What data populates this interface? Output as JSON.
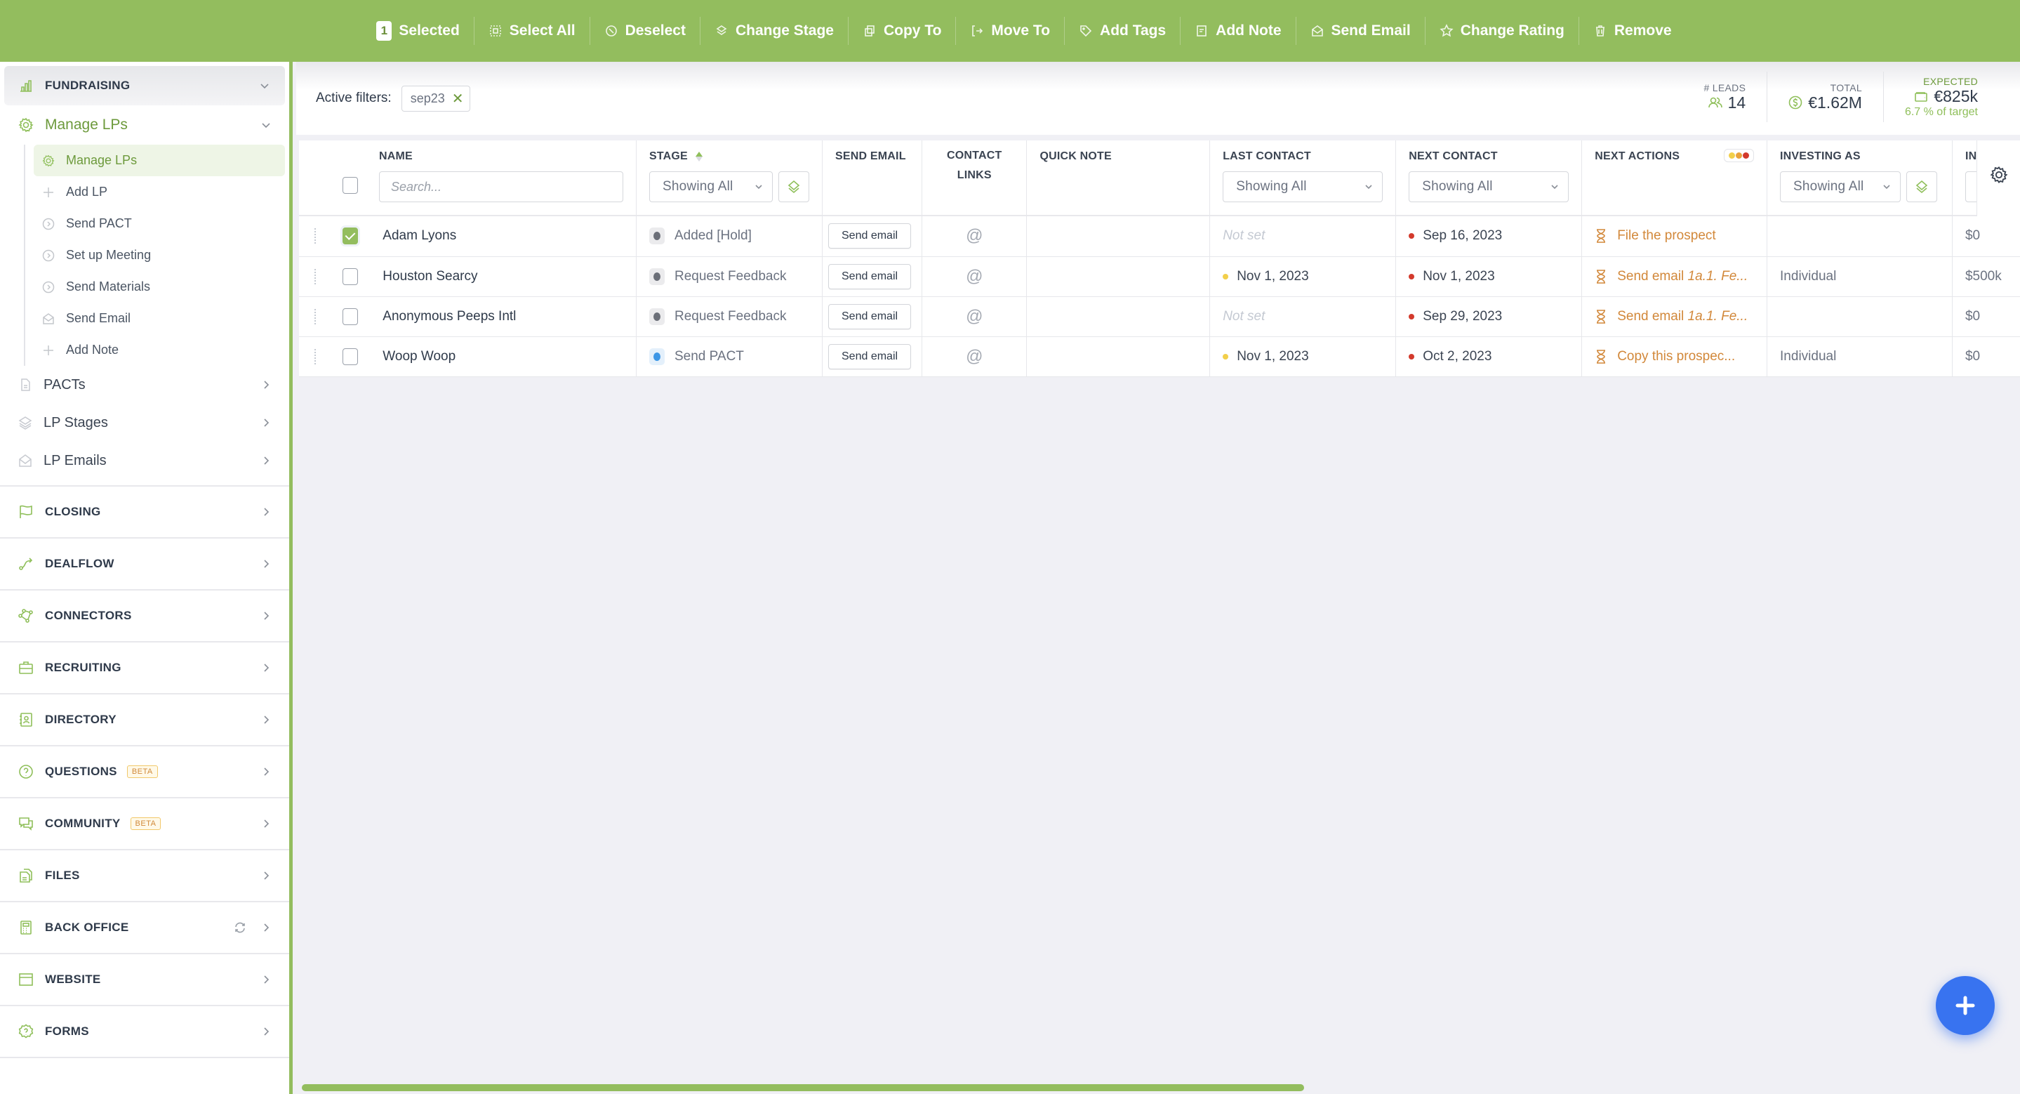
{
  "toolbar": {
    "selected_count": "1",
    "selected_label": "Selected",
    "actions": [
      {
        "label": "Select All",
        "icon": "select-all-icon"
      },
      {
        "label": "Deselect",
        "icon": "deselect-icon"
      },
      {
        "label": "Change Stage",
        "icon": "layers-icon"
      },
      {
        "label": "Copy To",
        "icon": "copy-icon"
      },
      {
        "label": "Move To",
        "icon": "move-icon"
      },
      {
        "label": "Add Tags",
        "icon": "tag-icon"
      },
      {
        "label": "Add Note",
        "icon": "note-icon"
      },
      {
        "label": "Send Email",
        "icon": "envelope-icon"
      },
      {
        "label": "Change Rating",
        "icon": "star-icon"
      },
      {
        "label": "Remove",
        "icon": "trash-icon"
      }
    ]
  },
  "sidebar": {
    "fundraising": {
      "label": "FUNDRAISING",
      "icon": "bar-chart-icon"
    },
    "manage_lps": {
      "label": "Manage LPs",
      "icon": "gear-icon",
      "items": [
        {
          "label": "Manage LPs",
          "icon": "gear-icon",
          "active": true
        },
        {
          "label": "Add LP",
          "icon": "plus-icon"
        },
        {
          "label": "Send PACT",
          "icon": "chevron-circle-icon"
        },
        {
          "label": "Set up Meeting",
          "icon": "chevron-circle-icon"
        },
        {
          "label": "Send Materials",
          "icon": "chevron-circle-icon"
        },
        {
          "label": "Send Email",
          "icon": "envelope-icon"
        },
        {
          "label": "Add Note",
          "icon": "plus-icon"
        }
      ]
    },
    "lp_links": [
      {
        "label": "PACTs",
        "icon": "document-icon"
      },
      {
        "label": "LP Stages",
        "icon": "layers-icon"
      },
      {
        "label": "LP Emails",
        "icon": "envelope-icon"
      }
    ],
    "sections": [
      {
        "label": "CLOSING",
        "icon": "flag-icon"
      },
      {
        "label": "DEALFLOW",
        "icon": "route-icon"
      },
      {
        "label": "CONNECTORS",
        "icon": "network-icon"
      },
      {
        "label": "RECRUITING",
        "icon": "briefcase-icon"
      },
      {
        "label": "DIRECTORY",
        "icon": "contact-book-icon"
      },
      {
        "label": "QUESTIONS",
        "icon": "question-circle-icon",
        "badge": "BETA"
      },
      {
        "label": "COMMUNITY",
        "icon": "chat-icon",
        "badge": "BETA"
      },
      {
        "label": "FILES",
        "icon": "files-icon"
      },
      {
        "label": "BACK OFFICE",
        "icon": "calculator-icon",
        "sync": true
      },
      {
        "label": "WEBSITE",
        "icon": "browser-icon"
      },
      {
        "label": "FORMS",
        "icon": "question-badge-icon"
      }
    ]
  },
  "filters": {
    "label": "Active filters:",
    "chips": [
      "sep23"
    ]
  },
  "stats": {
    "leads": {
      "caption": "# LEADS",
      "value": "14"
    },
    "total": {
      "caption": "TOTAL",
      "value": "€1.62M"
    },
    "expected": {
      "caption": "EXPECTED",
      "value": "€825k",
      "sub": "6.7 % of target"
    }
  },
  "table": {
    "columns": {
      "name": "NAME",
      "stage": "STAGE",
      "send_email": "SEND EMAIL",
      "contact_links": "CONTACT LINKS",
      "quick_note": "QUICK NOTE",
      "last_contact": "LAST CONTACT",
      "next_contact": "NEXT CONTACT",
      "next_actions": "NEXT ACTIONS",
      "investing_as": "INVESTING AS",
      "truncated": "IN"
    },
    "search_placeholder": "Search...",
    "filter_all": "Showing All",
    "send_email_label": "Send email",
    "contact_symbol": "@",
    "rows": [
      {
        "name": "Adam Lyons",
        "checked": true,
        "stage": "Added [Hold]",
        "stage_color": "gray",
        "last_contact": "Not set",
        "last_dot": "",
        "next_contact": "Sep 16, 2023",
        "next_dot": "#d33a2c",
        "action": "File the prospect",
        "action_em": "",
        "investing_as": "",
        "amount": "$0"
      },
      {
        "name": "Houston Searcy",
        "checked": false,
        "stage": "Request Feedback",
        "stage_color": "gray",
        "last_contact": "Nov 1, 2023",
        "last_dot": "#f2cf4a",
        "next_contact": "Nov 1, 2023",
        "next_dot": "#d33a2c",
        "action": "Send email ",
        "action_em": "1a.1. Fe...",
        "investing_as": "Individual",
        "amount": "$500k"
      },
      {
        "name": "Anonymous Peeps Intl",
        "checked": false,
        "stage": "Request Feedback",
        "stage_color": "gray",
        "last_contact": "Not set",
        "last_dot": "",
        "next_contact": "Sep 29, 2023",
        "next_dot": "#d33a2c",
        "action": "Send email ",
        "action_em": "1a.1. Fe...",
        "investing_as": "",
        "amount": "$0"
      },
      {
        "name": "Woop Woop",
        "checked": false,
        "stage": "Send PACT",
        "stage_color": "blue",
        "last_contact": "Nov 1, 2023",
        "last_dot": "#f2cf4a",
        "next_contact": "Oct 2, 2023",
        "next_dot": "#d33a2c",
        "action": "Copy this prospec...",
        "action_em": "",
        "investing_as": "Individual",
        "amount": "$0"
      }
    ]
  },
  "colors": {
    "brand_green": "#93bd5e",
    "fab_blue": "#3873f0",
    "action_orange": "#d2883a",
    "priority_dots": [
      "#f2cf4a",
      "#e9a23b",
      "#d33a2c"
    ]
  },
  "fab": {
    "icon": "plus-icon"
  }
}
